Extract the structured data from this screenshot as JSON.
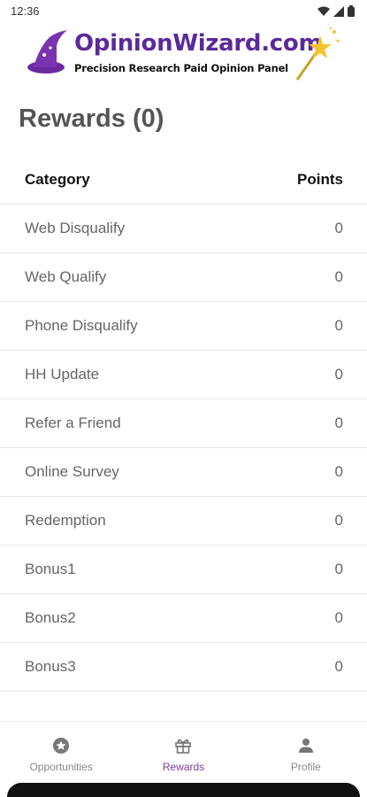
{
  "status": {
    "time": "12:36"
  },
  "header": {
    "logo_title": "OpinionWizard.com",
    "logo_subtitle": "Precision Research Paid Opinion Panel"
  },
  "page": {
    "title": "Rewards (0)"
  },
  "table": {
    "headers": {
      "category": "Category",
      "points": "Points"
    },
    "rows": [
      {
        "category": "Web Disqualify",
        "points": "0"
      },
      {
        "category": "Web Qualify",
        "points": "0"
      },
      {
        "category": "Phone Disqualify",
        "points": "0"
      },
      {
        "category": "HH Update",
        "points": "0"
      },
      {
        "category": "Refer a Friend",
        "points": "0"
      },
      {
        "category": "Online Survey",
        "points": "0"
      },
      {
        "category": "Redemption",
        "points": "0"
      },
      {
        "category": "Bonus1",
        "points": "0"
      },
      {
        "category": "Bonus2",
        "points": "0"
      },
      {
        "category": "Bonus3",
        "points": "0"
      }
    ]
  },
  "nav": {
    "items": [
      {
        "label": "Opportunities",
        "icon": "star-circle-icon"
      },
      {
        "label": "Rewards",
        "icon": "gift-icon",
        "active": true
      },
      {
        "label": "Profile",
        "icon": "person-icon"
      }
    ]
  },
  "colors": {
    "brand": "#5b2a9a",
    "active": "#7b3fa0"
  }
}
